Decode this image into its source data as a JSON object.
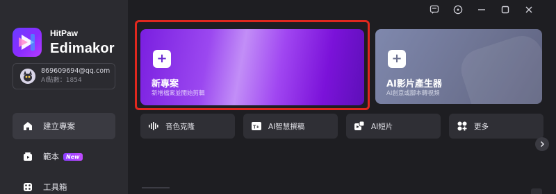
{
  "window": {
    "controls": [
      "feedback-icon",
      "info-icon",
      "minimize-icon",
      "maximize-icon",
      "close-icon"
    ]
  },
  "brand": {
    "company": "HitPaw",
    "product": "Edimakor"
  },
  "account": {
    "email": "869609694@qq.com",
    "points": "AI點數：1854"
  },
  "sidebar": {
    "items": [
      {
        "label": "建立專案",
        "icon": "home-icon",
        "active": true
      },
      {
        "label": "範本",
        "icon": "template-icon",
        "badge": "New"
      },
      {
        "label": "工具箱",
        "icon": "toolbox-icon"
      }
    ]
  },
  "cards": {
    "new_project": {
      "title": "新專案",
      "subtitle": "新增檔案並開始剪輯",
      "icon": "plus-icon"
    },
    "ai_video": {
      "title": "AI影片產生器",
      "subtitle": "AI創意或腳本轉視頻",
      "icon": "plus-icon"
    }
  },
  "tools": [
    {
      "label": "音色克隆",
      "icon": "waveform-icon"
    },
    {
      "label": "AI智慧撰稿",
      "icon": "ai-script-icon"
    },
    {
      "label": "AI短片",
      "icon": "ai-clip-icon"
    },
    {
      "label": "更多",
      "icon": "grid-more-icon"
    }
  ],
  "colors": {
    "accent": "#8b2cff",
    "highlight": "#e0281e",
    "background": "#1e1e22",
    "sidebar": "#2b2b30"
  }
}
